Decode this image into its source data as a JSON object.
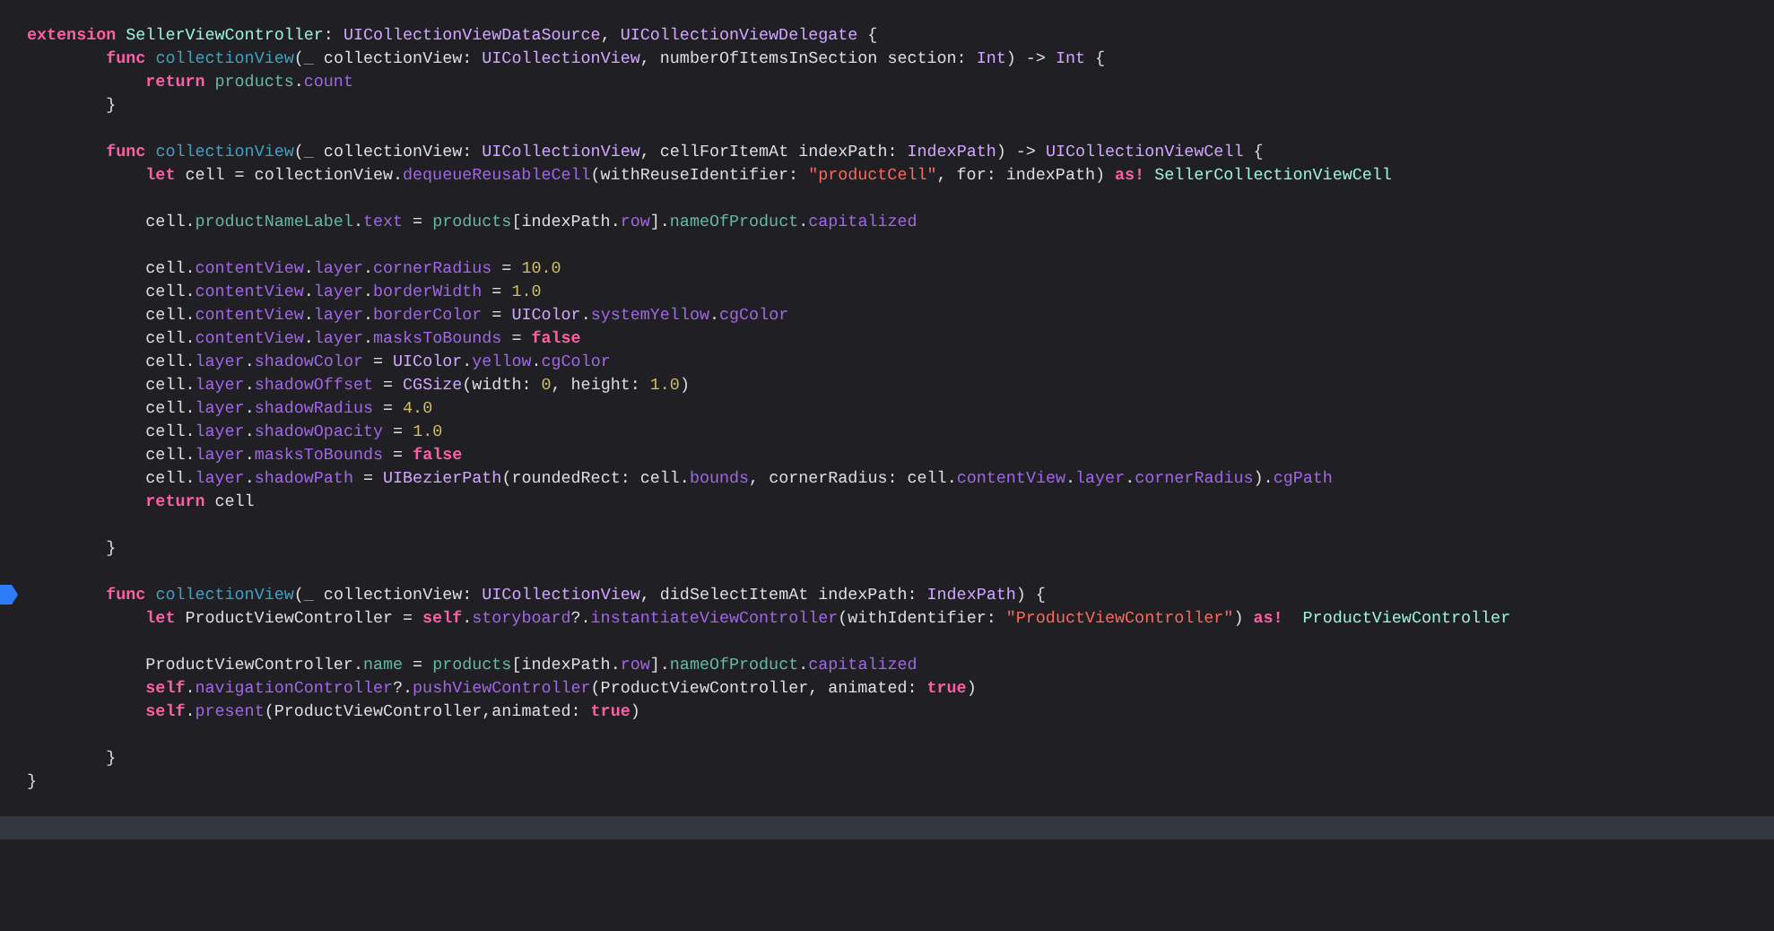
{
  "editor": {
    "lines": [
      {
        "breakpoint": false,
        "current": false
      },
      {
        "breakpoint": false,
        "current": false,
        "tokens": [
          {
            "kind": "keyword",
            "text": "extension "
          },
          {
            "kind": "project-type",
            "text": "SellerViewController"
          },
          {
            "kind": "plain",
            "text": ": "
          },
          {
            "kind": "type",
            "text": "UICollectionViewDataSource"
          },
          {
            "kind": "plain",
            "text": ", "
          },
          {
            "kind": "type",
            "text": "UICollectionViewDelegate"
          },
          {
            "kind": "plain",
            "text": " {"
          }
        ]
      },
      {
        "breakpoint": false,
        "current": false,
        "tokens": [
          {
            "kind": "keyword",
            "text": "        func "
          },
          {
            "kind": "declaration",
            "text": "collectionView"
          },
          {
            "kind": "plain",
            "text": "("
          },
          {
            "kind": "keyword",
            "text": "_"
          },
          {
            "kind": "plain",
            "text": " collectionView: "
          },
          {
            "kind": "type",
            "text": "UICollectionView"
          },
          {
            "kind": "plain",
            "text": ", numberOfItemsInSection section: "
          },
          {
            "kind": "type",
            "text": "Int"
          },
          {
            "kind": "plain",
            "text": ") -> "
          },
          {
            "kind": "type",
            "text": "Int"
          },
          {
            "kind": "plain",
            "text": " {"
          }
        ]
      },
      {
        "breakpoint": false,
        "current": false,
        "tokens": [
          {
            "kind": "keyword",
            "text": "            return "
          },
          {
            "kind": "project-member",
            "text": "products"
          },
          {
            "kind": "plain",
            "text": "."
          },
          {
            "kind": "member",
            "text": "count"
          }
        ]
      },
      {
        "breakpoint": false,
        "current": false,
        "tokens": [
          {
            "kind": "plain",
            "text": "        }"
          }
        ]
      },
      {
        "breakpoint": false,
        "current": false
      },
      {
        "breakpoint": false,
        "current": false,
        "tokens": [
          {
            "kind": "keyword",
            "text": "        func "
          },
          {
            "kind": "declaration",
            "text": "collectionView"
          },
          {
            "kind": "plain",
            "text": "("
          },
          {
            "kind": "keyword",
            "text": "_"
          },
          {
            "kind": "plain",
            "text": " collectionView: "
          },
          {
            "kind": "type",
            "text": "UICollectionView"
          },
          {
            "kind": "plain",
            "text": ", cellForItemAt indexPath: "
          },
          {
            "kind": "type",
            "text": "IndexPath"
          },
          {
            "kind": "plain",
            "text": ") -> "
          },
          {
            "kind": "type",
            "text": "UICollectionViewCell"
          },
          {
            "kind": "plain",
            "text": " {"
          }
        ]
      },
      {
        "breakpoint": false,
        "current": false,
        "tokens": [
          {
            "kind": "keyword",
            "text": "            let"
          },
          {
            "kind": "plain",
            "text": " cell = collectionView."
          },
          {
            "kind": "member",
            "text": "dequeueReusableCell"
          },
          {
            "kind": "plain",
            "text": "(withReuseIdentifier: "
          },
          {
            "kind": "string",
            "text": "\"productCell\""
          },
          {
            "kind": "plain",
            "text": ", for: indexPath) "
          },
          {
            "kind": "keyword",
            "text": "as! "
          },
          {
            "kind": "project-type",
            "text": "SellerCollectionViewCell"
          }
        ]
      },
      {
        "breakpoint": false,
        "current": false
      },
      {
        "breakpoint": false,
        "current": false,
        "tokens": [
          {
            "kind": "plain",
            "text": "            cell."
          },
          {
            "kind": "project-member",
            "text": "productNameLabel"
          },
          {
            "kind": "plain",
            "text": "."
          },
          {
            "kind": "member",
            "text": "text"
          },
          {
            "kind": "plain",
            "text": " = "
          },
          {
            "kind": "project-member",
            "text": "products"
          },
          {
            "kind": "plain",
            "text": "[indexPath."
          },
          {
            "kind": "member",
            "text": "row"
          },
          {
            "kind": "plain",
            "text": "]."
          },
          {
            "kind": "project-member",
            "text": "nameOfProduct"
          },
          {
            "kind": "plain",
            "text": "."
          },
          {
            "kind": "member",
            "text": "capitalized"
          }
        ]
      },
      {
        "breakpoint": false,
        "current": false
      },
      {
        "breakpoint": false,
        "current": false,
        "tokens": [
          {
            "kind": "plain",
            "text": "            cell."
          },
          {
            "kind": "member",
            "text": "contentView"
          },
          {
            "kind": "plain",
            "text": "."
          },
          {
            "kind": "member",
            "text": "layer"
          },
          {
            "kind": "plain",
            "text": "."
          },
          {
            "kind": "member",
            "text": "cornerRadius"
          },
          {
            "kind": "plain",
            "text": " = "
          },
          {
            "kind": "number",
            "text": "10.0"
          }
        ]
      },
      {
        "breakpoint": false,
        "current": false,
        "tokens": [
          {
            "kind": "plain",
            "text": "            cell."
          },
          {
            "kind": "member",
            "text": "contentView"
          },
          {
            "kind": "plain",
            "text": "."
          },
          {
            "kind": "member",
            "text": "layer"
          },
          {
            "kind": "plain",
            "text": "."
          },
          {
            "kind": "member",
            "text": "borderWidth"
          },
          {
            "kind": "plain",
            "text": " = "
          },
          {
            "kind": "number",
            "text": "1.0"
          }
        ]
      },
      {
        "breakpoint": false,
        "current": false,
        "tokens": [
          {
            "kind": "plain",
            "text": "            cell."
          },
          {
            "kind": "member",
            "text": "contentView"
          },
          {
            "kind": "plain",
            "text": "."
          },
          {
            "kind": "member",
            "text": "layer"
          },
          {
            "kind": "plain",
            "text": "."
          },
          {
            "kind": "member",
            "text": "borderColor"
          },
          {
            "kind": "plain",
            "text": " = "
          },
          {
            "kind": "type",
            "text": "UIColor"
          },
          {
            "kind": "plain",
            "text": "."
          },
          {
            "kind": "member",
            "text": "systemYellow"
          },
          {
            "kind": "plain",
            "text": "."
          },
          {
            "kind": "member",
            "text": "cgColor"
          }
        ]
      },
      {
        "breakpoint": false,
        "current": false,
        "tokens": [
          {
            "kind": "plain",
            "text": "            cell."
          },
          {
            "kind": "member",
            "text": "contentView"
          },
          {
            "kind": "plain",
            "text": "."
          },
          {
            "kind": "member",
            "text": "layer"
          },
          {
            "kind": "plain",
            "text": "."
          },
          {
            "kind": "member",
            "text": "masksToBounds"
          },
          {
            "kind": "plain",
            "text": " = "
          },
          {
            "kind": "keyword",
            "text": "false"
          }
        ]
      },
      {
        "breakpoint": false,
        "current": false,
        "tokens": [
          {
            "kind": "plain",
            "text": "            cell."
          },
          {
            "kind": "member",
            "text": "layer"
          },
          {
            "kind": "plain",
            "text": "."
          },
          {
            "kind": "member",
            "text": "shadowColor"
          },
          {
            "kind": "plain",
            "text": " = "
          },
          {
            "kind": "type",
            "text": "UIColor"
          },
          {
            "kind": "plain",
            "text": "."
          },
          {
            "kind": "member",
            "text": "yellow"
          },
          {
            "kind": "plain",
            "text": "."
          },
          {
            "kind": "member",
            "text": "cgColor"
          }
        ]
      },
      {
        "breakpoint": false,
        "current": false,
        "tokens": [
          {
            "kind": "plain",
            "text": "            cell."
          },
          {
            "kind": "member",
            "text": "layer"
          },
          {
            "kind": "plain",
            "text": "."
          },
          {
            "kind": "member",
            "text": "shadowOffset"
          },
          {
            "kind": "plain",
            "text": " = "
          },
          {
            "kind": "type",
            "text": "CGSize"
          },
          {
            "kind": "plain",
            "text": "(width: "
          },
          {
            "kind": "number",
            "text": "0"
          },
          {
            "kind": "plain",
            "text": ", height: "
          },
          {
            "kind": "number",
            "text": "1.0"
          },
          {
            "kind": "plain",
            "text": ")"
          }
        ]
      },
      {
        "breakpoint": false,
        "current": false,
        "tokens": [
          {
            "kind": "plain",
            "text": "            cell."
          },
          {
            "kind": "member",
            "text": "layer"
          },
          {
            "kind": "plain",
            "text": "."
          },
          {
            "kind": "member",
            "text": "shadowRadius"
          },
          {
            "kind": "plain",
            "text": " = "
          },
          {
            "kind": "number",
            "text": "4.0"
          }
        ]
      },
      {
        "breakpoint": false,
        "current": false,
        "tokens": [
          {
            "kind": "plain",
            "text": "            cell."
          },
          {
            "kind": "member",
            "text": "layer"
          },
          {
            "kind": "plain",
            "text": "."
          },
          {
            "kind": "member",
            "text": "shadowOpacity"
          },
          {
            "kind": "plain",
            "text": " = "
          },
          {
            "kind": "number",
            "text": "1.0"
          }
        ]
      },
      {
        "breakpoint": false,
        "current": false,
        "tokens": [
          {
            "kind": "plain",
            "text": "            cell."
          },
          {
            "kind": "member",
            "text": "layer"
          },
          {
            "kind": "plain",
            "text": "."
          },
          {
            "kind": "member",
            "text": "masksToBounds"
          },
          {
            "kind": "plain",
            "text": " = "
          },
          {
            "kind": "keyword",
            "text": "false"
          }
        ]
      },
      {
        "breakpoint": false,
        "current": false,
        "tokens": [
          {
            "kind": "plain",
            "text": "            cell."
          },
          {
            "kind": "member",
            "text": "layer"
          },
          {
            "kind": "plain",
            "text": "."
          },
          {
            "kind": "member",
            "text": "shadowPath"
          },
          {
            "kind": "plain",
            "text": " = "
          },
          {
            "kind": "type",
            "text": "UIBezierPath"
          },
          {
            "kind": "plain",
            "text": "(roundedRect: cell."
          },
          {
            "kind": "member",
            "text": "bounds"
          },
          {
            "kind": "plain",
            "text": ", cornerRadius: cell."
          },
          {
            "kind": "member",
            "text": "contentView"
          },
          {
            "kind": "plain",
            "text": "."
          },
          {
            "kind": "member",
            "text": "layer"
          },
          {
            "kind": "plain",
            "text": "."
          },
          {
            "kind": "member",
            "text": "cornerRadius"
          },
          {
            "kind": "plain",
            "text": ")."
          },
          {
            "kind": "member",
            "text": "cgPath"
          }
        ]
      },
      {
        "breakpoint": false,
        "current": false,
        "tokens": [
          {
            "kind": "keyword",
            "text": "            return"
          },
          {
            "kind": "plain",
            "text": " cell"
          }
        ]
      },
      {
        "breakpoint": false,
        "current": false
      },
      {
        "breakpoint": false,
        "current": false,
        "tokens": [
          {
            "kind": "plain",
            "text": "        }"
          }
        ]
      },
      {
        "breakpoint": false,
        "current": false
      },
      {
        "breakpoint": true,
        "current": false,
        "tokens": [
          {
            "kind": "keyword",
            "text": "        func "
          },
          {
            "kind": "declaration",
            "text": "collectionView"
          },
          {
            "kind": "plain",
            "text": "("
          },
          {
            "kind": "keyword",
            "text": "_"
          },
          {
            "kind": "plain",
            "text": " collectionView: "
          },
          {
            "kind": "type",
            "text": "UICollectionView"
          },
          {
            "kind": "plain",
            "text": ", didSelectItemAt indexPath: "
          },
          {
            "kind": "type",
            "text": "IndexPath"
          },
          {
            "kind": "plain",
            "text": ") {"
          }
        ]
      },
      {
        "breakpoint": false,
        "current": false,
        "tokens": [
          {
            "kind": "keyword",
            "text": "            let"
          },
          {
            "kind": "plain",
            "text": " ProductViewController = "
          },
          {
            "kind": "keyword",
            "text": "self"
          },
          {
            "kind": "plain",
            "text": "."
          },
          {
            "kind": "member",
            "text": "storyboard"
          },
          {
            "kind": "plain",
            "text": "?."
          },
          {
            "kind": "member",
            "text": "instantiateViewController"
          },
          {
            "kind": "plain",
            "text": "(withIdentifier: "
          },
          {
            "kind": "string",
            "text": "\"ProductViewController\""
          },
          {
            "kind": "plain",
            "text": ") "
          },
          {
            "kind": "keyword",
            "text": "as!  "
          },
          {
            "kind": "project-type",
            "text": "ProductViewController"
          }
        ]
      },
      {
        "breakpoint": false,
        "current": false
      },
      {
        "breakpoint": false,
        "current": false,
        "tokens": [
          {
            "kind": "plain",
            "text": "            ProductViewController."
          },
          {
            "kind": "project-member",
            "text": "name"
          },
          {
            "kind": "plain",
            "text": " = "
          },
          {
            "kind": "project-member",
            "text": "products"
          },
          {
            "kind": "plain",
            "text": "[indexPath."
          },
          {
            "kind": "member",
            "text": "row"
          },
          {
            "kind": "plain",
            "text": "]."
          },
          {
            "kind": "project-member",
            "text": "nameOfProduct"
          },
          {
            "kind": "plain",
            "text": "."
          },
          {
            "kind": "member",
            "text": "capitalized"
          }
        ]
      },
      {
        "breakpoint": false,
        "current": false,
        "tokens": [
          {
            "kind": "keyword",
            "text": "            self"
          },
          {
            "kind": "plain",
            "text": "."
          },
          {
            "kind": "member",
            "text": "navigationController"
          },
          {
            "kind": "plain",
            "text": "?."
          },
          {
            "kind": "member",
            "text": "pushViewController"
          },
          {
            "kind": "plain",
            "text": "(ProductViewController, animated: "
          },
          {
            "kind": "keyword",
            "text": "true"
          },
          {
            "kind": "plain",
            "text": ")"
          }
        ]
      },
      {
        "breakpoint": false,
        "current": false,
        "tokens": [
          {
            "kind": "keyword",
            "text": "            self"
          },
          {
            "kind": "plain",
            "text": "."
          },
          {
            "kind": "member",
            "text": "present"
          },
          {
            "kind": "plain",
            "text": "(ProductViewController,animated: "
          },
          {
            "kind": "keyword",
            "text": "true"
          },
          {
            "kind": "plain",
            "text": ")"
          }
        ]
      },
      {
        "breakpoint": false,
        "current": false
      },
      {
        "breakpoint": false,
        "current": false,
        "tokens": [
          {
            "kind": "plain",
            "text": "        }"
          }
        ]
      },
      {
        "breakpoint": false,
        "current": false,
        "tokens": [
          {
            "kind": "plain",
            "text": "}"
          }
        ]
      },
      {
        "breakpoint": false,
        "current": false
      },
      {
        "breakpoint": false,
        "current": true
      },
      {
        "breakpoint": false,
        "current": false
      },
      {
        "breakpoint": false,
        "current": false
      }
    ]
  }
}
